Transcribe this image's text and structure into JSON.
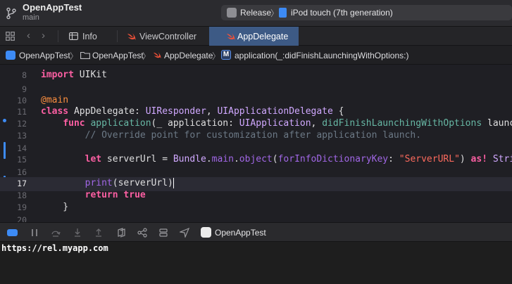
{
  "titlebar": {
    "project": "OpenAppTest",
    "branch": "main",
    "scheme": "Release",
    "scheme_separator": "〉",
    "device": "iPod touch (7th generation)"
  },
  "tabs": [
    {
      "label": "Info",
      "icon": "info-table-icon"
    },
    {
      "label": "ViewController",
      "icon": "swift-icon"
    },
    {
      "label": "AppDelegate",
      "icon": "swift-icon",
      "active": true
    }
  ],
  "nav": {
    "back": "‹",
    "forward": "›"
  },
  "breadcrumb": {
    "items": [
      "OpenAppTest",
      "OpenAppTest",
      "AppDelegate",
      "application(_:didFinishLaunchingWithOptions:)"
    ],
    "separator": "〉",
    "method_badge": "M"
  },
  "editor": {
    "lines": [
      {
        "num": "8"
      },
      {
        "num": "9"
      },
      {
        "num": "10"
      },
      {
        "num": "11"
      },
      {
        "num": "12"
      },
      {
        "num": "13"
      },
      {
        "num": "14"
      },
      {
        "num": "15"
      },
      {
        "num": "16"
      },
      {
        "num": "17"
      },
      {
        "num": "18"
      },
      {
        "num": "19"
      },
      {
        "num": "20"
      }
    ],
    "tokens": {
      "l8_kw": "import",
      "l8_rest": " UIKit",
      "l10_attr": "@main",
      "l11_kw": "class",
      "l11_name": " AppDelegate: ",
      "l11_t1": "UIResponder",
      "l11_sep": ", ",
      "l11_t2": "UIApplicationDelegate",
      "l11_end": " {",
      "l12_indent": "    ",
      "l12_kw": "func",
      "l12_sp": " ",
      "l12_fn": "application",
      "l12_p1": "(_ application: ",
      "l12_t1": "UIApplication",
      "l12_sep": ", ",
      "l12_label": "didFinishLaunchingWithOptions",
      "l12_rest": " launchOpti",
      "l13_comment": "        // Override point for customization after application launch.",
      "l15_indent": "        ",
      "l15_kw": "let",
      "l15_a": " serverUrl = ",
      "l15_t1": "Bundle",
      "l15_dot": ".",
      "l15_main": "main",
      "l15_dot2": ".",
      "l15_obj": "object",
      "l15_paren": "(",
      "l15_label": "forInfoDictionaryKey",
      "l15_colon": ": ",
      "l15_str": "\"ServerURL\"",
      "l15_close": ") ",
      "l15_as": "as!",
      "l15_sp": " ",
      "l15_t2": "String",
      "l17_indent": "        ",
      "l17_fn": "print",
      "l17_rest": "(serverUrl)",
      "l18_indent": "        ",
      "l18_kw": "return",
      "l18_sp": " ",
      "l18_true": "true",
      "l19_brace": "    }"
    }
  },
  "debug": {
    "process": "OpenAppTest"
  },
  "console": {
    "output": "https://rel.myapp.com"
  },
  "colors": {
    "accent": "#3d8bf5",
    "active_tab": "#3d5a85",
    "keyword": "#fc5fa3",
    "string": "#fc6a5d",
    "comment": "#6c7986"
  }
}
